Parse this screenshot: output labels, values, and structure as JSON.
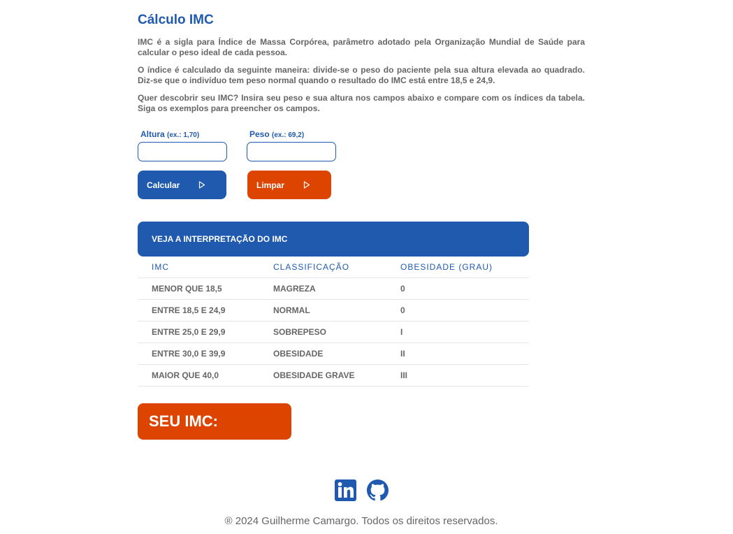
{
  "page": {
    "title": "Cálculo IMC",
    "paragraphs": [
      "IMC é a sigla para Índice de Massa Corpórea, parâmetro adotado pela Organização Mundial de Saúde para calcular o peso ideal de cada pessoa.",
      "O índice é calculado da seguinte maneira: divide-se o peso do paciente pela sua altura elevada ao quadrado. Diz-se que o indivíduo tem peso normal quando o resultado do IMC está entre 18,5 e 24,9.",
      "Quer descobrir seu IMC? Insira seu peso e sua altura nos campos abaixo e compare com os índices da tabela. Siga os exemplos para preencher os campos."
    ]
  },
  "form": {
    "altura_label": "Altura",
    "altura_hint": "(ex.: 1,70)",
    "altura_value": "",
    "peso_label": "Peso",
    "peso_hint": "(ex.: 69,2)",
    "peso_value": "",
    "calc_label": "Calcular",
    "clear_label": "Limpar"
  },
  "table": {
    "heading": "VEJA A INTERPRETAÇÃO DO IMC",
    "columns": [
      "IMC",
      "CLASSIFICAÇÃO",
      "OBESIDADE (GRAU)"
    ],
    "rows": [
      [
        "MENOR QUE 18,5",
        "MAGREZA",
        "0"
      ],
      [
        "ENTRE 18,5 E 24,9",
        "NORMAL",
        "0"
      ],
      [
        "ENTRE 25,0 E 29,9",
        "SOBREPESO",
        "I"
      ],
      [
        "ENTRE 30,0 E 39,9",
        "OBESIDADE",
        "II"
      ],
      [
        "MAIOR QUE 40,0",
        "OBESIDADE GRAVE",
        "III"
      ]
    ]
  },
  "result": {
    "label": "SEU IMC:",
    "value": ""
  },
  "social": {
    "icons": [
      "linkedin-icon",
      "github-icon"
    ]
  },
  "footer": {
    "text": "® 2024 Guilherme Camargo. Todos os direitos reservados."
  },
  "colors": {
    "primary": "#1f5aae",
    "accent": "#dd4400",
    "text": "#666666"
  }
}
